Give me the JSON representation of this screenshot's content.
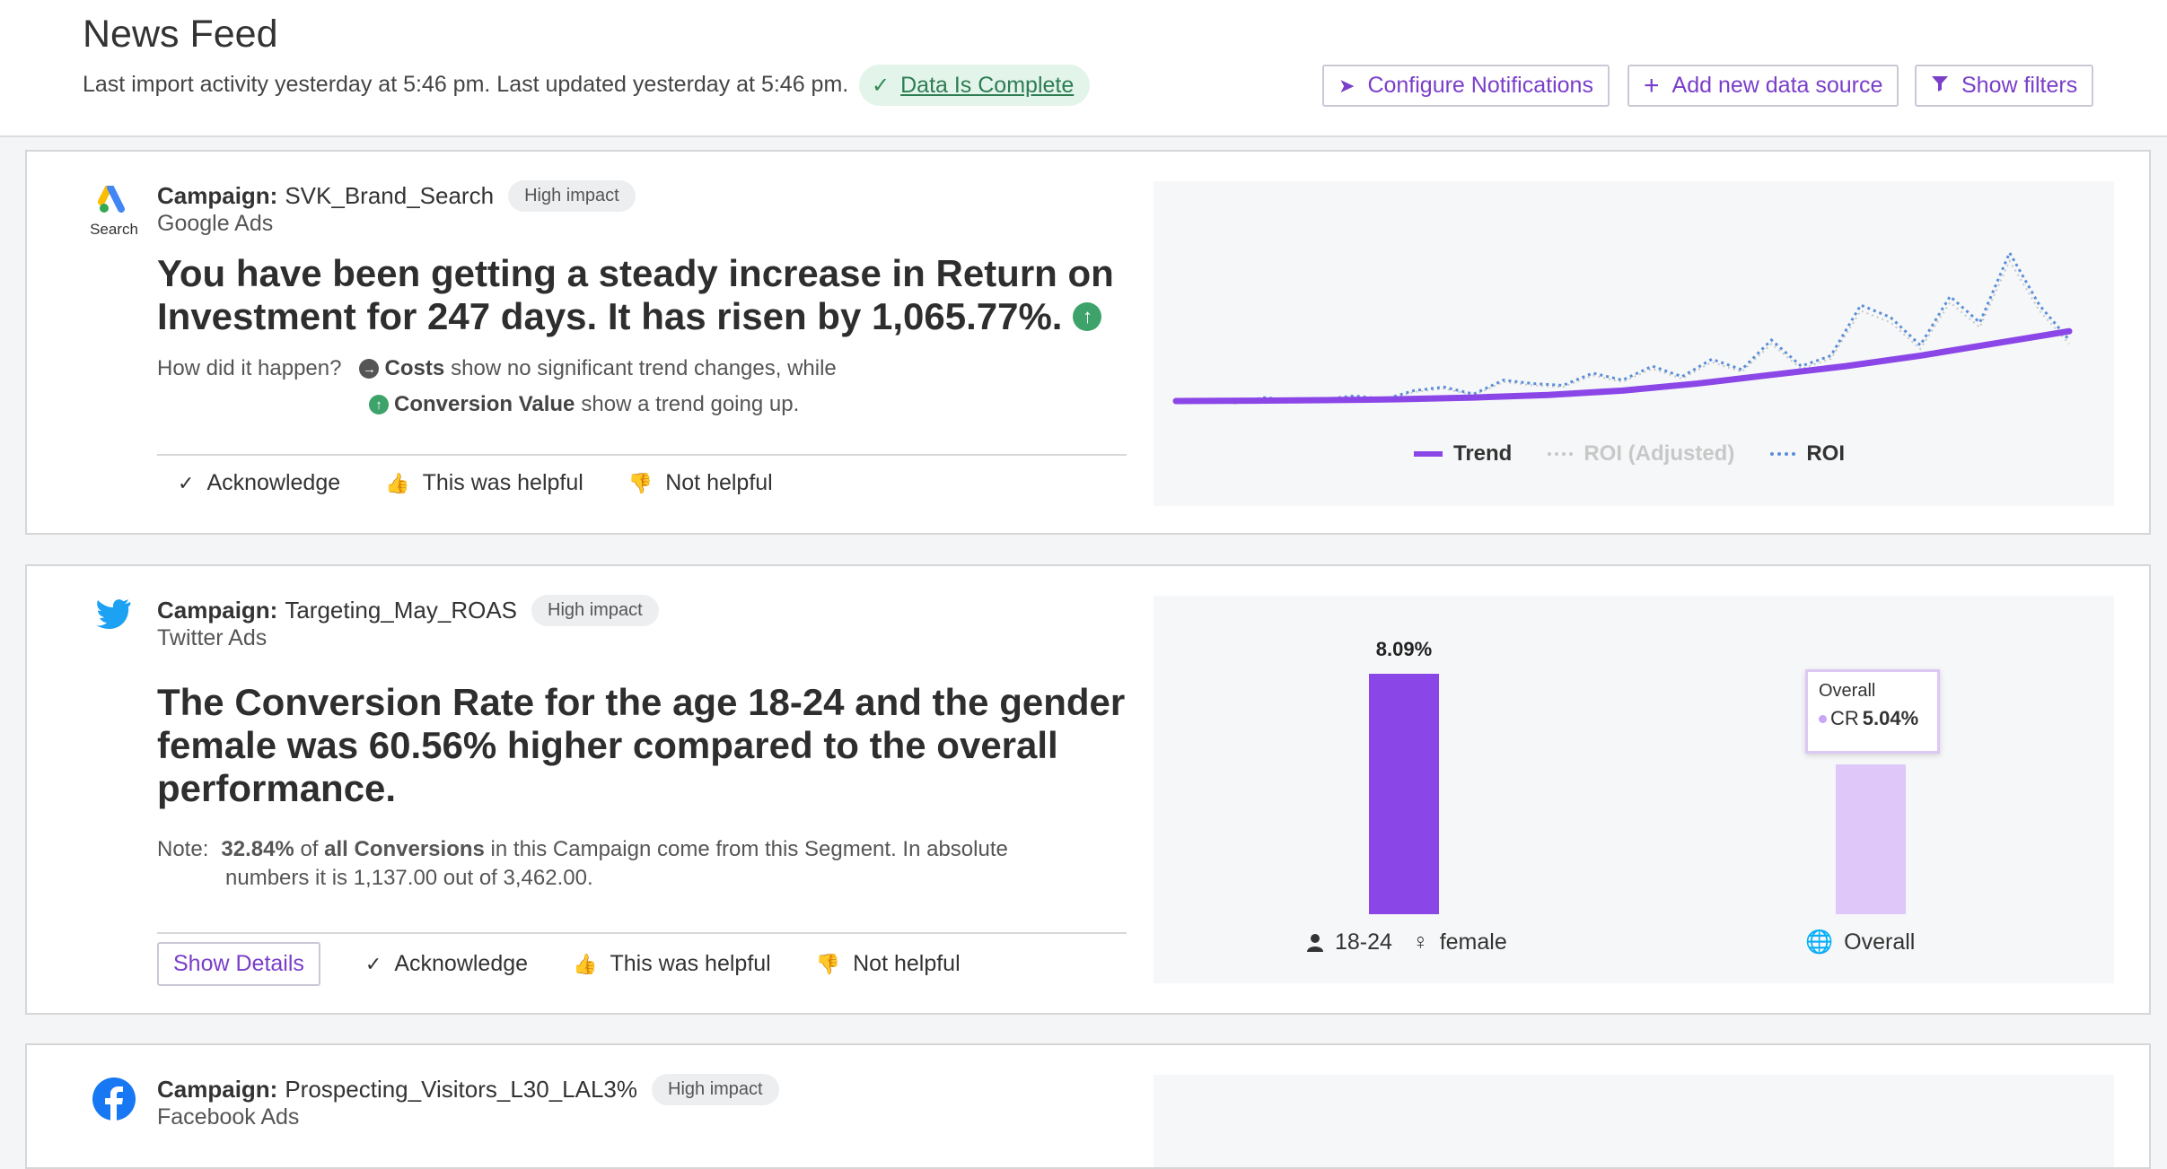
{
  "header": {
    "title": "News Feed",
    "subtitle": "Last import activity yesterday at 5:46 pm. Last updated yesterday at 5:46 pm.",
    "status_link": "Data Is Complete",
    "buttons": {
      "configure": "Configure Notifications",
      "add_source": "Add new data source",
      "show_filters": "Show filters"
    }
  },
  "actions": {
    "acknowledge": "Acknowledge",
    "helpful": "This was helpful",
    "not_helpful": "Not helpful",
    "show_details": "Show Details"
  },
  "cards": [
    {
      "logo_label": "Search",
      "campaign_label": "Campaign:",
      "campaign_name": "SVK_Brand_Search",
      "impact": "High impact",
      "source": "Google Ads",
      "headline_line1": "You have been getting a steady increase in Return on",
      "headline_line2": "Investment for 247 days. It has risen by 1,065.77%.",
      "how_label": "How did it happen?",
      "reason1_metric": "Costs",
      "reason1_text": "show no significant trend changes, while",
      "reason2_metric": "Conversion Value",
      "reason2_text": "show a trend going up."
    },
    {
      "campaign_label": "Campaign:",
      "campaign_name": "Targeting_May_ROAS",
      "impact": "High impact",
      "source": "Twitter Ads",
      "headline_line1": "The Conversion Rate for the age 18-24 and the gender",
      "headline_line2": "female was 60.56% higher compared to the overall",
      "headline_line3": "performance.",
      "note_label": "Note:",
      "note_pct": "32.84%",
      "note_of": "of",
      "note_metric": "all Conversions",
      "note_text": "in this Campaign come from this Segment. In absolute",
      "note_line2": "numbers it is 1,137.00 out of 3,462.00."
    },
    {
      "campaign_label": "Campaign:",
      "campaign_name": "Prospecting_Visitors_L30_LAL3%",
      "impact": "High impact",
      "source": "Facebook Ads"
    }
  ],
  "chart_data": [
    {
      "type": "line",
      "legend": [
        "Trend",
        "ROI (Adjusted)",
        "ROI"
      ],
      "colors": {
        "trend": "#8b46e8",
        "roi_adjusted": "#c8c8c8",
        "roi": "#5b8ed8"
      },
      "x_days": 247,
      "series": [
        {
          "name": "Trend",
          "values": [
            1.0,
            1.02,
            1.05,
            1.1,
            1.2,
            1.35,
            1.6,
            2.0,
            2.5,
            3.0,
            3.6,
            4.3,
            5.0
          ]
        },
        {
          "name": "ROI",
          "values": [
            1.0,
            1.1,
            0.9,
            1.2,
            1.0,
            1.1,
            1.3,
            1.1,
            1.6,
            1.8,
            1.4,
            2.2,
            2.0,
            1.9,
            2.6,
            2.2,
            3.0,
            2.4,
            3.4,
            2.8,
            4.5,
            3.0,
            3.6,
            6.5,
            5.8,
            4.2,
            7.0,
            5.5,
            9.5,
            6.5,
            4.5
          ]
        }
      ]
    },
    {
      "type": "bar",
      "categories": [
        "18-24 female",
        "Overall"
      ],
      "category_labels": {
        "age": "18-24",
        "gender": "female",
        "overall": "Overall"
      },
      "values": [
        8.09,
        5.04
      ],
      "value_labels": [
        "8.09%",
        "5.04%"
      ],
      "ylim": [
        0,
        8.09
      ],
      "colors": [
        "#8b46e8",
        "#dfc7fa"
      ],
      "tooltip": {
        "title": "Overall",
        "series": "CR",
        "value": "5.04%"
      }
    }
  ]
}
